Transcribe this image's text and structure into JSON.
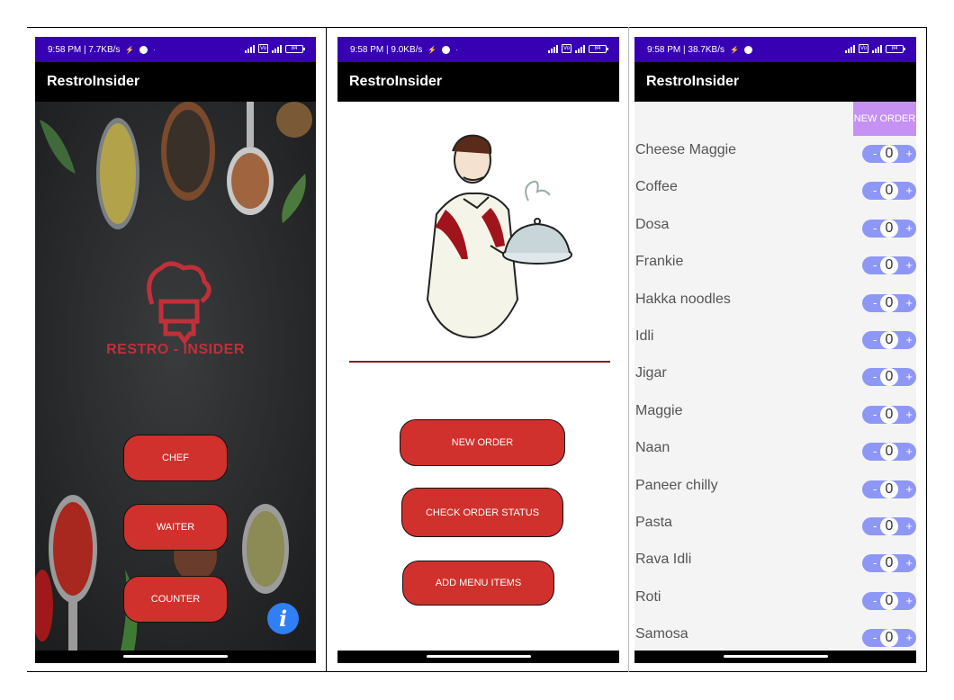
{
  "status_bars": [
    {
      "time_speed": "9:58 PM | 7.7KB/s",
      "battery": "84"
    },
    {
      "time_speed": "9:58 PM | 9.0KB/s",
      "battery": "84"
    },
    {
      "time_speed": "9:58 PM | 38.7KB/s",
      "battery": "84"
    }
  ],
  "app_title": "RestroInsider",
  "home": {
    "brand": "RESTRO - INSIDER",
    "buttons": {
      "chef": "CHEF",
      "waiter": "WAITER",
      "counter": "COUNTER"
    },
    "info_glyph": "i"
  },
  "waiter": {
    "buttons": {
      "new_order": "NEW ORDER",
      "check_status": "CHECK ORDER STATUS",
      "add_menu": "ADD MENU ITEMS"
    }
  },
  "order": {
    "new_order_label": "NEW ORDER",
    "items": [
      {
        "name": "Cheese Maggie",
        "qty": "0"
      },
      {
        "name": "Coffee",
        "qty": "0"
      },
      {
        "name": "Dosa",
        "qty": "0"
      },
      {
        "name": "Frankie",
        "qty": "0"
      },
      {
        "name": "Hakka noodles",
        "qty": "0"
      },
      {
        "name": "Idli",
        "qty": "0"
      },
      {
        "name": "Jigar",
        "qty": "0"
      },
      {
        "name": "Maggie",
        "qty": "0"
      },
      {
        "name": "Naan",
        "qty": "0"
      },
      {
        "name": "Paneer chilly",
        "qty": "0"
      },
      {
        "name": "Pasta",
        "qty": "0"
      },
      {
        "name": "Rava Idli",
        "qty": "0"
      },
      {
        "name": "Roti",
        "qty": "0"
      },
      {
        "name": "Samosa",
        "qty": "0"
      }
    ],
    "minus_glyph": "-",
    "plus_glyph": "+"
  },
  "colors": {
    "status_bar": "#3700b3",
    "app_bar": "#000000",
    "primary_button": "#d0312d",
    "stepper": "#8e97f5",
    "new_order_chip": "#c591f2",
    "info_fab": "#2f7ff5"
  }
}
